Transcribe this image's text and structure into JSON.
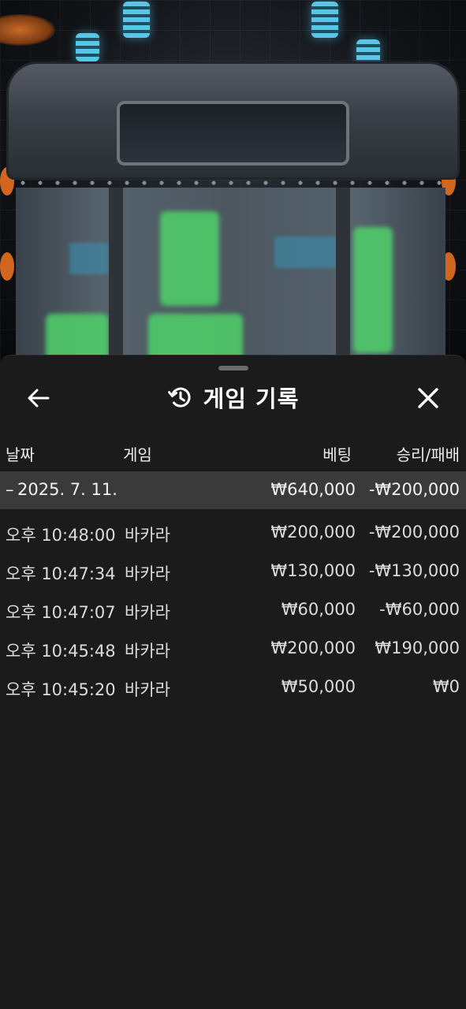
{
  "header": {
    "title": "게임 기록"
  },
  "columns": {
    "date": "날짜",
    "game": "게임",
    "bet": "베팅",
    "win_loss": "승리/패배"
  },
  "date_group": {
    "toggle": "–",
    "date": "2025. 7. 11.",
    "total_bet": "₩640,000",
    "total_win_loss": "-₩200,000"
  },
  "rows": [
    {
      "time": "오후 10:48:00",
      "game": "바카라",
      "bet": "₩200,000",
      "win_loss": "-₩200,000"
    },
    {
      "time": "오후 10:47:34",
      "game": "바카라",
      "bet": "₩130,000",
      "win_loss": "-₩130,000"
    },
    {
      "time": "오후 10:47:07",
      "game": "바카라",
      "bet": "₩60,000",
      "win_loss": "-₩60,000"
    },
    {
      "time": "오후 10:45:48",
      "game": "바카라",
      "bet": "₩200,000",
      "win_loss": "₩190,000"
    },
    {
      "time": "오후 10:45:20",
      "game": "바카라",
      "bet": "₩50,000",
      "win_loss": "₩0"
    }
  ],
  "icons": {
    "back": "back-arrow-icon",
    "history": "history-icon",
    "close": "close-icon"
  },
  "colors": {
    "sheet_bg": "#1b1b1b",
    "date_row_bg": "#3a3a3a",
    "text": "#f2f2f2"
  }
}
